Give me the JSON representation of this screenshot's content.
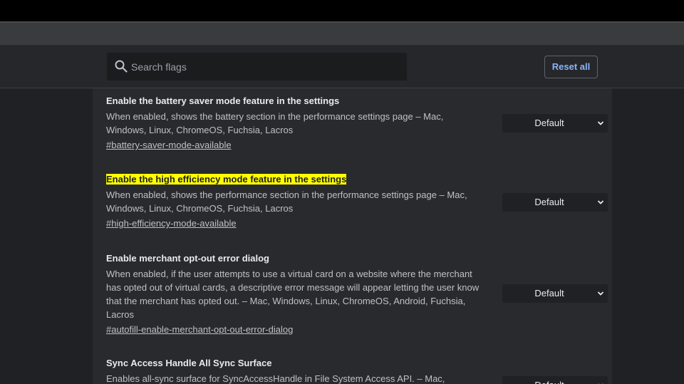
{
  "search": {
    "placeholder": "Search flags"
  },
  "header": {
    "reset_label": "Reset all"
  },
  "flags": [
    {
      "title": "Enable the battery saver mode feature in the settings",
      "description": "When enabled, shows the battery section in the performance settings page – Mac, Windows, Linux, ChromeOS, Fuchsia, Lacros",
      "link": "#battery-saver-mode-available",
      "value": "Default",
      "highlighted": false
    },
    {
      "title": "Enable the high efficiency mode feature in the settings",
      "description": "When enabled, shows the performance section in the performance settings page – Mac, Windows, Linux, ChromeOS, Fuchsia, Lacros",
      "link": "#high-efficiency-mode-available",
      "value": "Default",
      "highlighted": true
    },
    {
      "title": "Enable merchant opt-out error dialog",
      "description": "When enabled, if the user attempts to use a virtual card on a website where the merchant has opted out of virtual cards, a descriptive error message will appear letting the user know that the merchant has opted out. – Mac, Windows, Linux, ChromeOS, Android, Fuchsia, Lacros",
      "link": "#autofill-enable-merchant-opt-out-error-dialog",
      "value": "Default",
      "highlighted": false
    },
    {
      "title": "Sync Access Handle All Sync Surface",
      "description": "Enables all-sync surface for SyncAccessHandle in File System Access API. – Mac, Windows,",
      "link": "",
      "value": "Default",
      "highlighted": false
    }
  ],
  "colors": {
    "page_bg": "#202124",
    "panel_bg": "#292a2d",
    "accent": "#8ab4f8",
    "highlight": "#ffff00"
  },
  "icons": {
    "search": "search-icon",
    "dropdown": "chevron-down-icon"
  }
}
